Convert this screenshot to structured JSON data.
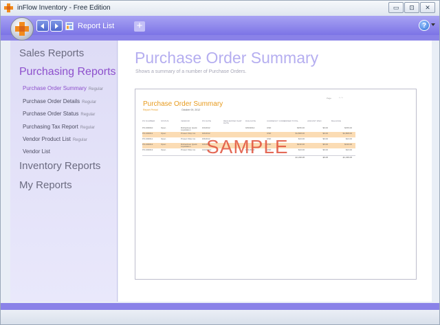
{
  "window": {
    "title": "inFlow Inventory - Free Edition",
    "minimize_label": "▭",
    "maximize_label": "⊡",
    "close_label": "✕"
  },
  "toolbar": {
    "tab_label": "Report List",
    "new_tab_label": "+",
    "help_label": "?"
  },
  "sidebar": {
    "sections": {
      "sales": "Sales Reports",
      "purchasing": "Purchasing Reports",
      "inventory": "Inventory Reports",
      "my": "My Reports"
    },
    "purchasing_items": [
      {
        "label": "Purchase Order Summary",
        "badge": "Regular"
      },
      {
        "label": "Purchase Order Details",
        "badge": "Regular"
      },
      {
        "label": "Purchase Order Status",
        "badge": "Regular"
      },
      {
        "label": "Purchasing Tax Report",
        "badge": "Regular"
      },
      {
        "label": "Vendor Product List",
        "badge": "Regular"
      },
      {
        "label": "Vendor List",
        "badge": ""
      }
    ]
  },
  "main": {
    "title": "Purchase Order Summary",
    "subtitle": "Shows a summary of a number of Purchase Orders."
  },
  "preview": {
    "title": "Purchase Order Summary",
    "period_label": "Report Period",
    "period_value": "October 09, 2012",
    "page_label": "Page",
    "page_nav": "1 / 1",
    "watermark": "SAMPLE",
    "columns": [
      "PO NUMBER",
      "STATUS",
      "VENDOR",
      "PO DATE",
      "REQUESTED SHIP DATE",
      "DUE DATE",
      "CURRENCY CODE",
      "ORDER TOTAL",
      "AMOUNT PAID",
      "BALANCE"
    ],
    "rows": [
      [
        "PO-000010",
        "Open",
        "Richardson Quick Liquidation",
        "9/1/2012",
        "",
        "9/30/2012",
        "USD",
        "$156.00",
        "$0.00",
        "$156.00"
      ],
      [
        "PO-000011",
        "Open",
        "Protect Ship Inc.",
        "9/2/2012",
        "",
        "",
        "USD",
        "$1,808.00",
        "$0.00",
        "$1,808.00"
      ],
      [
        "PO-000011",
        "Open",
        "Protect Ship Inc.",
        "9/3/2012",
        "",
        "",
        "USD",
        "$13.00",
        "$0.00",
        "$13.00"
      ],
      [
        "PO-000012",
        "Open",
        "Richardson Quick Liquidation",
        "9/4/2012",
        "",
        "",
        "USD",
        "$130.00",
        "$0.00",
        "$130.00"
      ],
      [
        "PO-000013",
        "Open",
        "Protect Ship Inc.",
        "10/2/2012",
        "",
        "11/1/2012",
        "USD",
        "$13.00",
        "$0.00",
        "$13.00"
      ]
    ],
    "totals": [
      "$1,330.00",
      "$0.00",
      "$1,330.00"
    ]
  }
}
